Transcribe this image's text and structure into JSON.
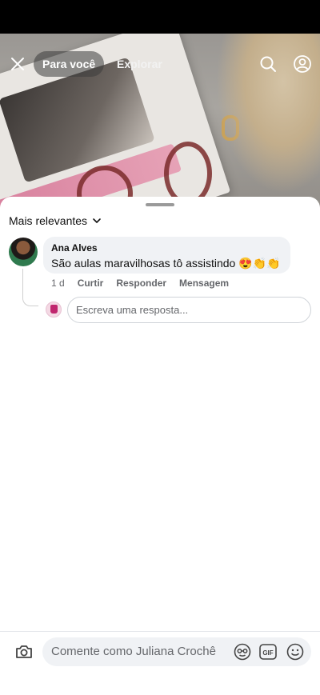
{
  "header": {
    "tabs": [
      {
        "label": "Para você",
        "active": true
      },
      {
        "label": "Explorar",
        "active": false
      }
    ],
    "icons": [
      "close-icon",
      "search-icon",
      "profile-icon"
    ]
  },
  "sheet": {
    "sort_label": "Mais relevantes"
  },
  "comment": {
    "author": "Ana Alves",
    "text": "São aulas maravilhosas tô assistindo 😍👏👏",
    "time": "1 d",
    "actions": {
      "like": "Curtir",
      "reply": "Responder",
      "message": "Mensagem"
    }
  },
  "reply": {
    "placeholder": "Escreva uma resposta..."
  },
  "composer": {
    "placeholder": "Comente como Juliana Crochê",
    "icons": [
      "camera-icon",
      "avatar-sticker-icon",
      "gif-icon",
      "emoji-icon"
    ]
  },
  "colors": {
    "bubble": "#f0f2f5",
    "secondary_text": "#65676b",
    "primary_text": "#111111"
  }
}
